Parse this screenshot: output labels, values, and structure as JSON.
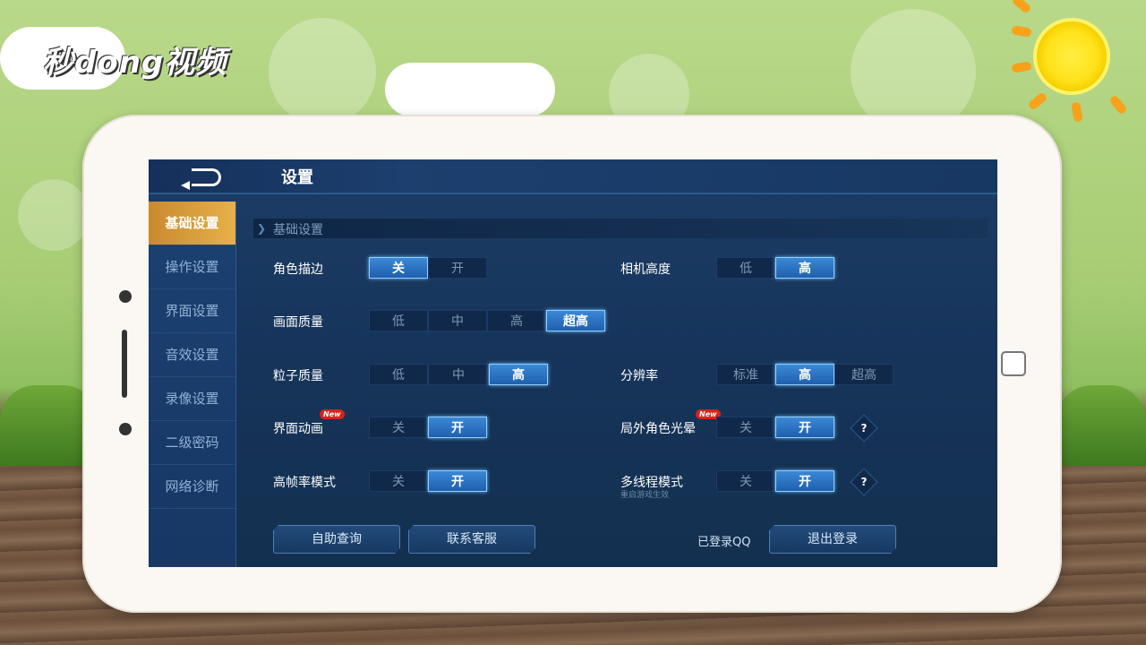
{
  "watermark": {
    "logo_text": "秒dong视频"
  },
  "app": {
    "title": "设置",
    "sidebar": [
      {
        "label": "基础设置",
        "active": true
      },
      {
        "label": "操作设置",
        "active": false
      },
      {
        "label": "界面设置",
        "active": false
      },
      {
        "label": "音效设置",
        "active": false
      },
      {
        "label": "录像设置",
        "active": false
      },
      {
        "label": "二级密码",
        "active": false
      },
      {
        "label": "网络诊断",
        "active": false
      }
    ],
    "section_title": "基础设置",
    "settings": {
      "outline": {
        "label": "角色描边",
        "options": [
          "关",
          "开"
        ],
        "selected": "关"
      },
      "camera_height": {
        "label": "相机高度",
        "options": [
          "低",
          "高"
        ],
        "selected": "高"
      },
      "graphics_quality": {
        "label": "画面质量",
        "options": [
          "低",
          "中",
          "高",
          "超高"
        ],
        "selected": "超高"
      },
      "particle_quality": {
        "label": "粒子质量",
        "options": [
          "低",
          "中",
          "高"
        ],
        "selected": "高"
      },
      "resolution": {
        "label": "分辨率",
        "options": [
          "标准",
          "高",
          "超高"
        ],
        "selected": "高"
      },
      "ui_animation": {
        "label": "界面动画",
        "badge": "New",
        "options": [
          "关",
          "开"
        ],
        "selected": "开"
      },
      "outer_glow": {
        "label": "局外角色光晕",
        "badge": "New",
        "options": [
          "关",
          "开"
        ],
        "selected": "开",
        "help": "?"
      },
      "high_fps": {
        "label": "高帧率模式",
        "options": [
          "关",
          "开"
        ],
        "selected": "开"
      },
      "multithread": {
        "label": "多线程模式",
        "note": "重启游戏生效",
        "options": [
          "关",
          "开"
        ],
        "selected": "开",
        "help": "?"
      }
    },
    "footer": {
      "self_help": "自助查询",
      "contact": "联系客服",
      "login_status": "已登录QQ",
      "logout": "退出登录"
    }
  },
  "colors": {
    "accent": "#3b89d6",
    "active_tab": "#e7b04a",
    "badge": "#d6241a"
  }
}
